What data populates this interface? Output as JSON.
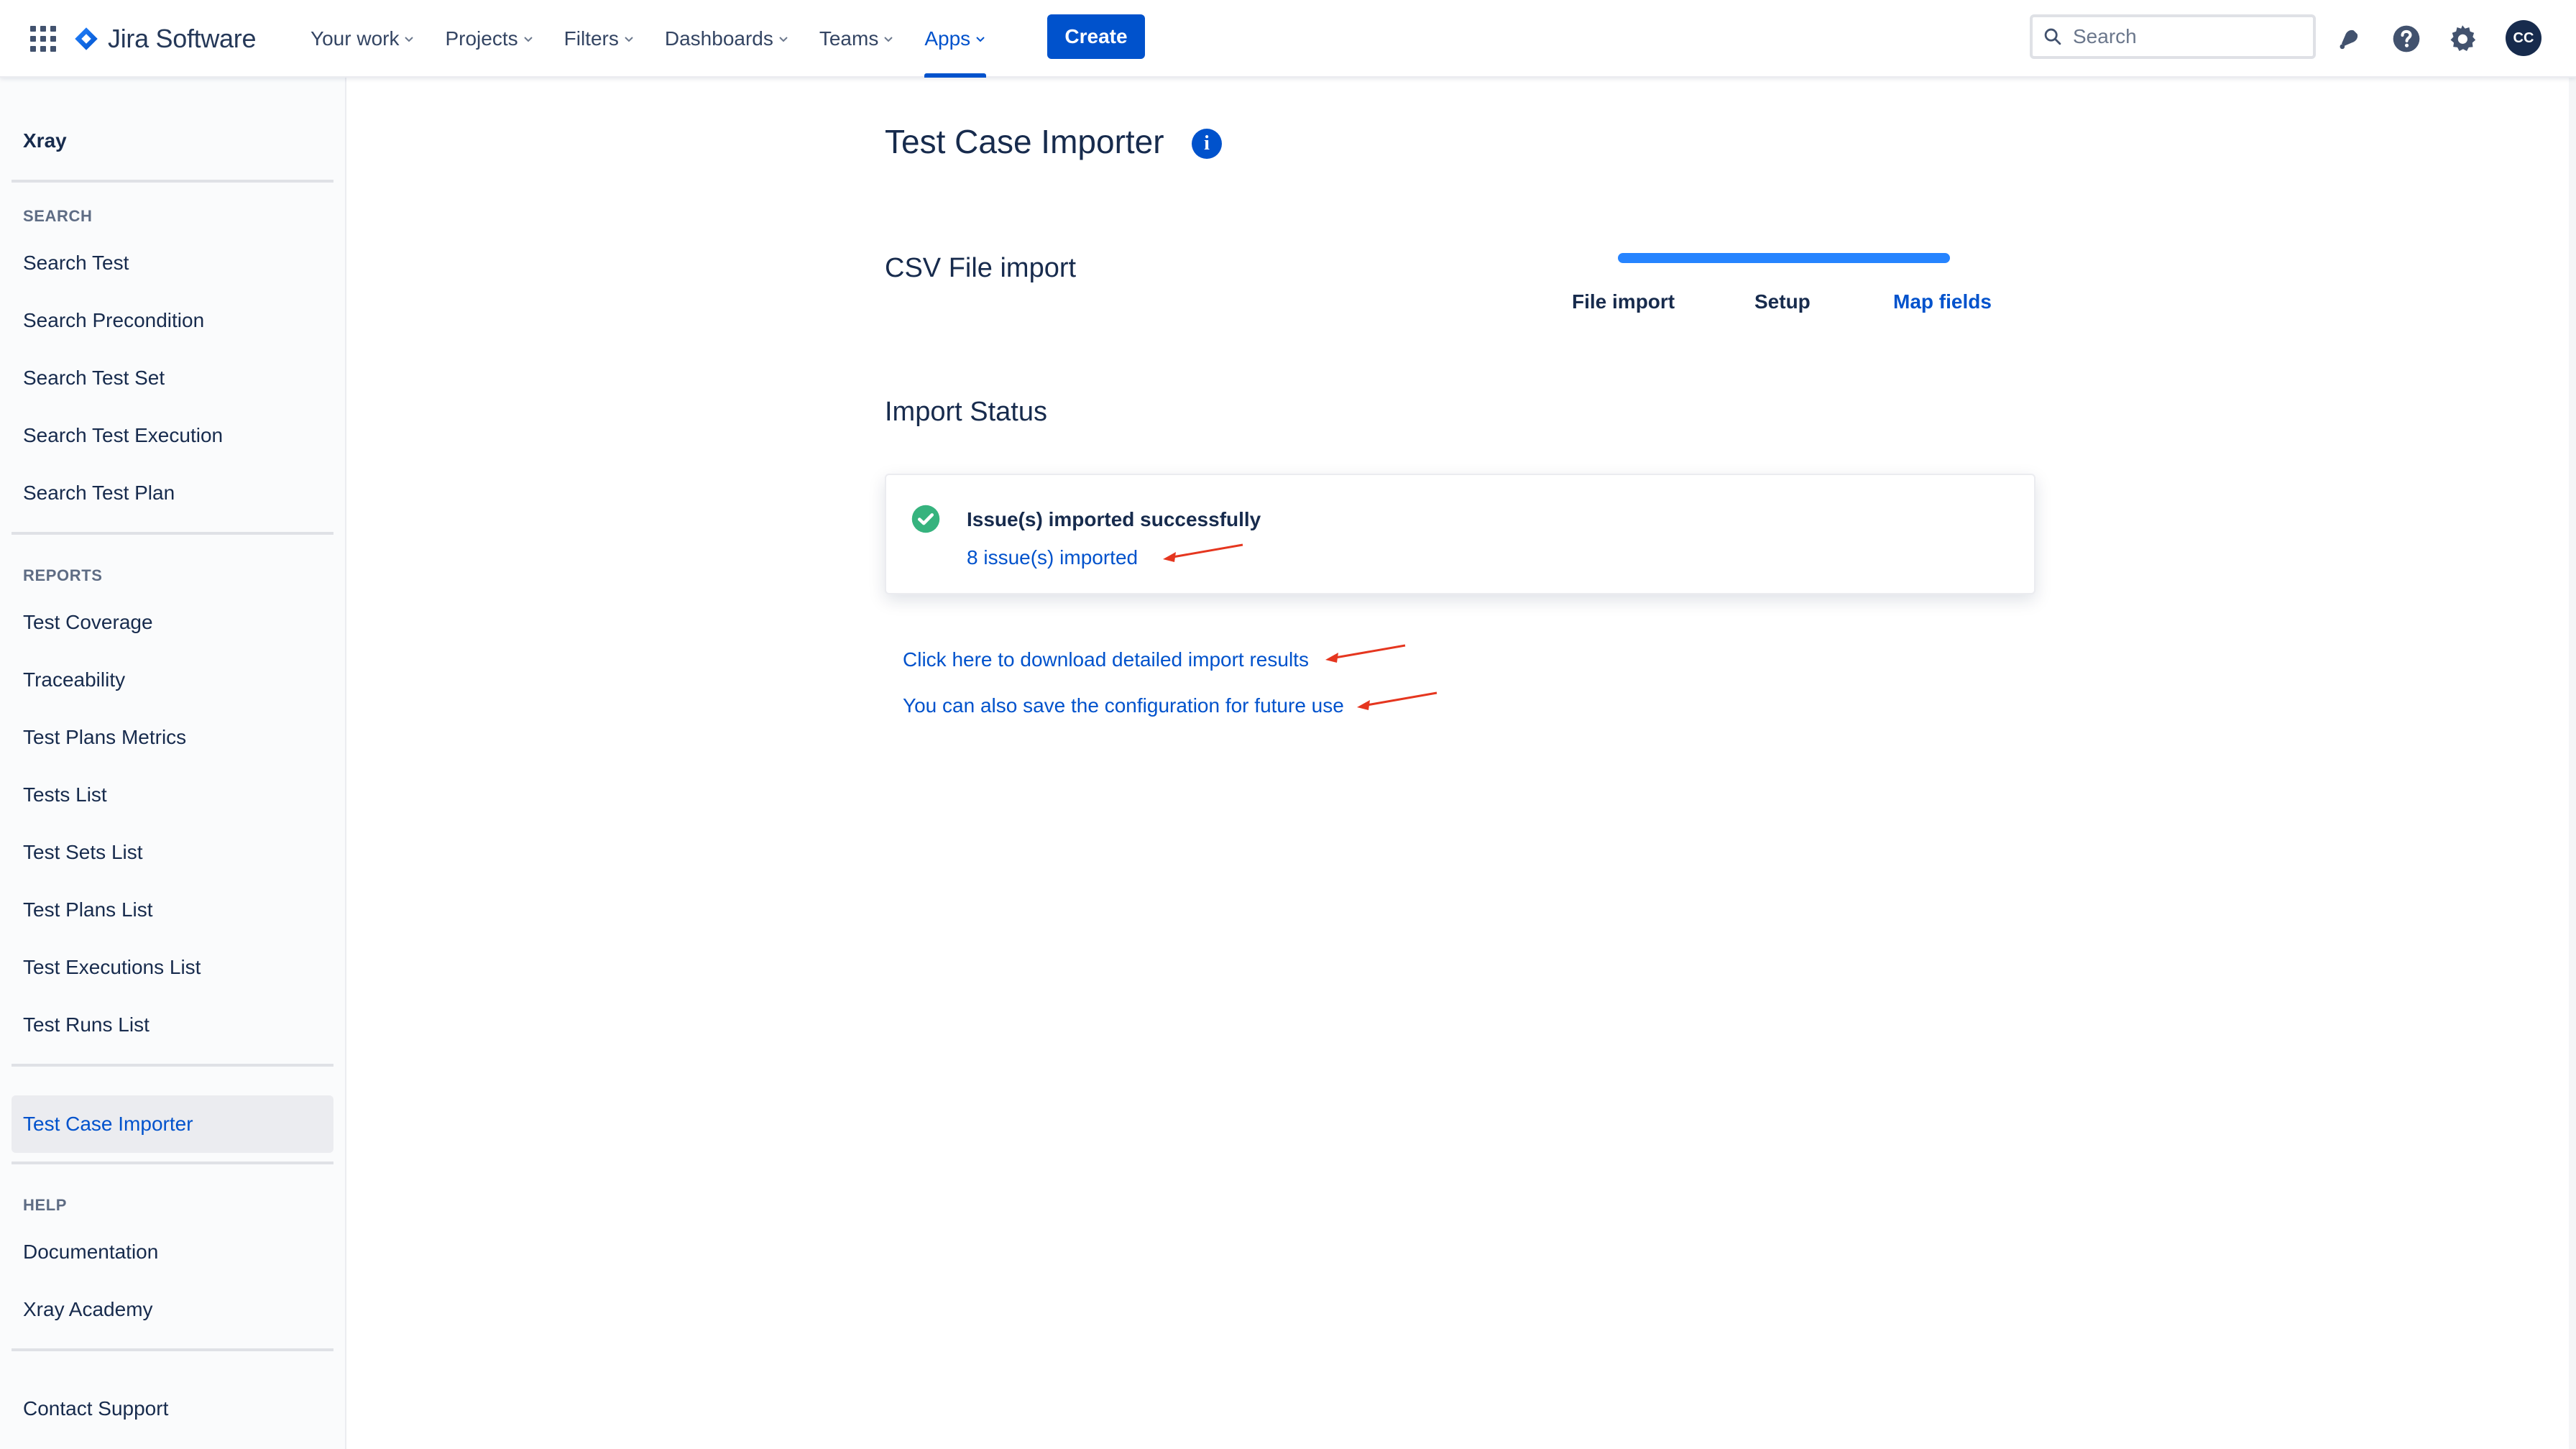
{
  "topnav": {
    "logo_text": "Jira Software",
    "items": [
      {
        "label": "Your work"
      },
      {
        "label": "Projects"
      },
      {
        "label": "Filters"
      },
      {
        "label": "Dashboards"
      },
      {
        "label": "Teams"
      },
      {
        "label": "Apps",
        "active": true
      }
    ],
    "create_label": "Create",
    "search_placeholder": "Search",
    "avatar_initials": "CC",
    "icons": [
      "app-switcher-icon",
      "notifications-icon",
      "help-icon",
      "settings-icon"
    ]
  },
  "sidebar": {
    "title": "Xray",
    "sections": [
      {
        "heading": "SEARCH",
        "items": [
          "Search Test",
          "Search Precondition",
          "Search Test Set",
          "Search Test Execution",
          "Search Test Plan"
        ]
      },
      {
        "heading": "REPORTS",
        "items": [
          "Test Coverage",
          "Traceability",
          "Test Plans Metrics",
          "Tests List",
          "Test Sets List",
          "Test Plans List",
          "Test Executions List",
          "Test Runs List"
        ]
      },
      {
        "heading": "",
        "items": [
          "Test Case Importer"
        ],
        "active": "Test Case Importer"
      },
      {
        "heading": "HELP",
        "items": [
          "Documentation",
          "Xray Academy"
        ]
      },
      {
        "heading": "",
        "items": [
          "Contact Support"
        ]
      }
    ]
  },
  "main": {
    "title": "Test Case Importer",
    "csv_section_title": "CSV File import",
    "stepper": {
      "steps": [
        "File import",
        "Setup",
        "Map fields"
      ],
      "current": "Map fields",
      "progress": 1.0
    },
    "import_status_title": "Import Status",
    "status_card": {
      "heading": "Issue(s) imported successfully",
      "link": "8 issue(s) imported"
    },
    "links": {
      "download": "Click here to download detailed import results",
      "save_config": "You can also save the configuration for future use"
    }
  },
  "colors": {
    "brand_blue": "#0052CC",
    "success_green": "#36B37E",
    "annotation_red": "#E5361F",
    "text_dark": "#172B4D"
  }
}
